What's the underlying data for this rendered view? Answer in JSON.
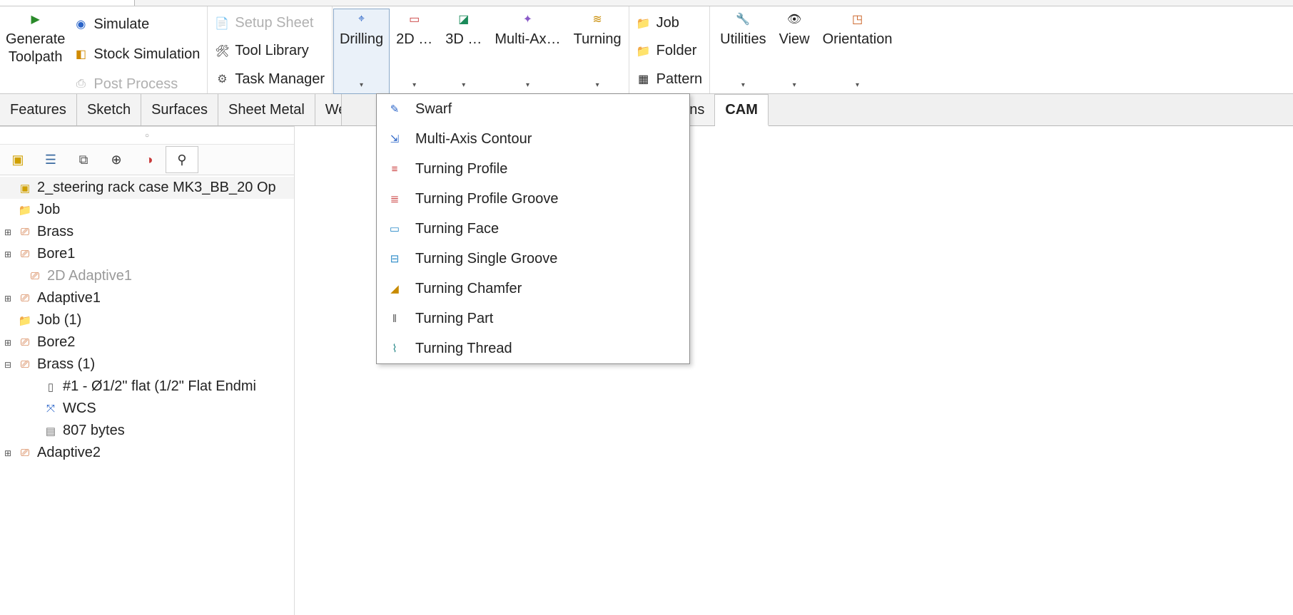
{
  "ribbon": {
    "generate_toolpath": "Generate\nToolpath",
    "simulate": "Simulate",
    "stock_sim": "Stock Simulation",
    "post_process": "Post Process",
    "setup_sheet": "Setup Sheet",
    "tool_library": "Tool Library",
    "task_manager": "Task Manager",
    "drilling": "Drilling",
    "two_d": "2D …",
    "three_d": "3D …",
    "multi_axis": "Multi-Ax…",
    "turning": "Turning",
    "job": "Job",
    "folder": "Folder",
    "pattern": "Pattern",
    "utilities": "Utilities",
    "view": "View",
    "orientation": "Orientation"
  },
  "tabs": {
    "features": "Features",
    "sketch": "Sketch",
    "surfaces": "Surfaces",
    "sheet_metal": "Sheet Metal",
    "weld_trunc": "We",
    "addins_trunc": "dd-Ins",
    "cam": "CAM"
  },
  "tree": {
    "root": "2_steering rack case MK3_BB_20 Op",
    "items": [
      {
        "label": "Job",
        "type": "job",
        "depth": 0,
        "twist": ""
      },
      {
        "label": "Brass",
        "type": "op",
        "depth": 0,
        "twist": "+"
      },
      {
        "label": "Bore1",
        "type": "op",
        "depth": 0,
        "twist": "+"
      },
      {
        "label": "2D Adaptive1",
        "type": "op",
        "depth": 1,
        "twist": "",
        "muted": true
      },
      {
        "label": "Adaptive1",
        "type": "op",
        "depth": 0,
        "twist": "+"
      },
      {
        "label": "Job (1)",
        "type": "job",
        "depth": 0,
        "twist": ""
      },
      {
        "label": "Bore2",
        "type": "op",
        "depth": 0,
        "twist": "+"
      },
      {
        "label": "Brass (1)",
        "type": "op",
        "depth": 0,
        "twist": "−"
      },
      {
        "label": "#1 - Ø1/2\" flat (1/2\" Flat Endmi",
        "type": "em",
        "depth": 2,
        "twist": ""
      },
      {
        "label": "WCS",
        "type": "wcs",
        "depth": 2,
        "twist": ""
      },
      {
        "label": "807 bytes",
        "type": "bytes",
        "depth": 2,
        "twist": ""
      },
      {
        "label": "Adaptive2",
        "type": "op",
        "depth": 0,
        "twist": "+"
      }
    ]
  },
  "menu": [
    {
      "icon": "ic-swarf",
      "label": "Swarf"
    },
    {
      "icon": "ic-mac",
      "label": "Multi-Axis Contour"
    },
    {
      "icon": "ic-tp",
      "label": "Turning Profile"
    },
    {
      "icon": "ic-tpg",
      "label": "Turning Profile Groove"
    },
    {
      "icon": "ic-tf",
      "label": "Turning Face"
    },
    {
      "icon": "ic-tsg",
      "label": "Turning Single Groove"
    },
    {
      "icon": "ic-tc",
      "label": "Turning Chamfer"
    },
    {
      "icon": "ic-tpart",
      "label": "Turning Part"
    },
    {
      "icon": "ic-tth",
      "label": "Turning Thread"
    }
  ]
}
